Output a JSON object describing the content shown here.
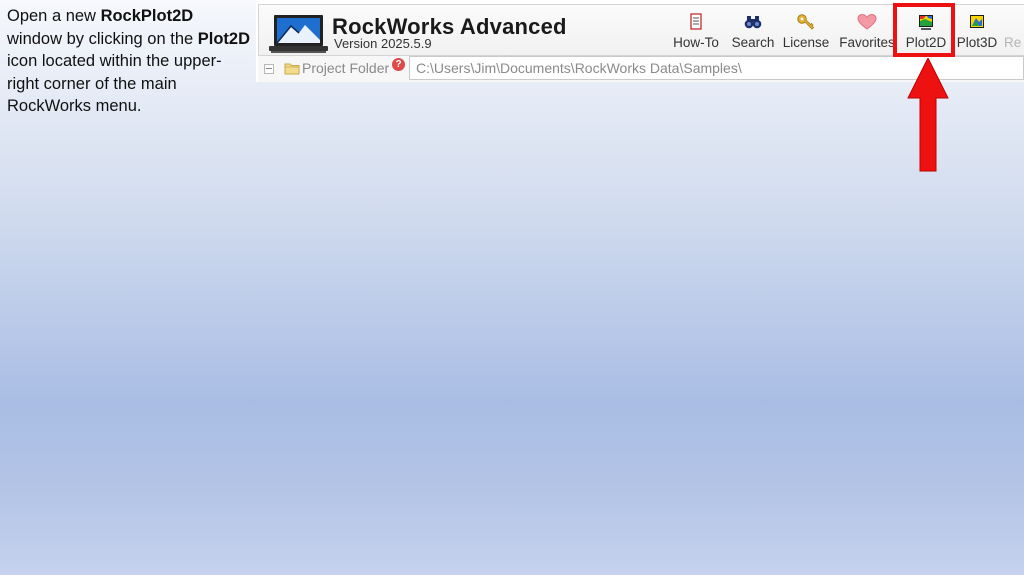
{
  "instructions": {
    "part1": "Open a new ",
    "bold1": "RockPlot2D",
    "part2": " window by clicking on the ",
    "bold2": "Plot2D",
    "part3": " icon located within the upper-right corner of the main RockWorks menu."
  },
  "app": {
    "title": "RockWorks Advanced",
    "version": "Version 2025.5.9"
  },
  "toolbar": {
    "items": [
      {
        "label": "How-To",
        "icon": "book-icon"
      },
      {
        "label": "Search",
        "icon": "binoculars-icon"
      },
      {
        "label": "License",
        "icon": "key-icon"
      },
      {
        "label": "Favorites",
        "icon": "heart-icon"
      },
      {
        "label": "Plot2D",
        "icon": "plot2d-icon"
      },
      {
        "label": "Plot3D",
        "icon": "plot3d-icon"
      },
      {
        "label": "Re",
        "icon": "cut-off-tool"
      }
    ]
  },
  "project": {
    "label": "Project Folder",
    "help": "?",
    "path": "C:\\Users\\Jim\\Documents\\RockWorks Data\\Samples\\"
  },
  "colors": {
    "highlight": "#ee1111",
    "arrow": "#ee1111"
  }
}
